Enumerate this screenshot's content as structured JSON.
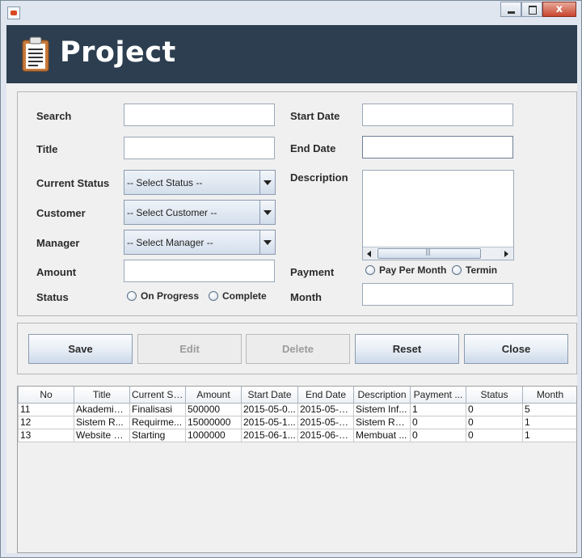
{
  "window": {
    "controls": {
      "minimize_icon": "minimize-icon",
      "maximize_icon": "maximize-icon",
      "close_glyph": "x"
    }
  },
  "header": {
    "title": "Project",
    "icon": "clipboard-icon"
  },
  "form": {
    "search": {
      "label": "Search",
      "value": ""
    },
    "title": {
      "label": "Title",
      "value": ""
    },
    "current_status": {
      "label": "Current Status",
      "selected": "-- Select Status --"
    },
    "customer": {
      "label": "Customer",
      "selected": "-- Select Customer --"
    },
    "manager": {
      "label": "Manager",
      "selected": "-- Select Manager --"
    },
    "amount": {
      "label": "Amount",
      "value": ""
    },
    "status": {
      "label": "Status",
      "options": [
        "On Progress",
        "Complete"
      ]
    },
    "start_date": {
      "label": "Start Date",
      "value": ""
    },
    "end_date": {
      "label": "End Date",
      "value": ""
    },
    "description": {
      "label": "Description",
      "value": ""
    },
    "payment": {
      "label": "Payment",
      "options": [
        "Pay Per Month",
        "Termin"
      ]
    },
    "month": {
      "label": "Month",
      "value": ""
    }
  },
  "buttons": {
    "save": "Save",
    "edit": "Edit",
    "delete": "Delete",
    "reset": "Reset",
    "close": "Close"
  },
  "table": {
    "columns": [
      "No",
      "Title",
      "Current St...",
      "Amount",
      "Start Date",
      "End Date",
      "Description",
      "Payment ...",
      "Status",
      "Month"
    ],
    "rows": [
      [
        "11",
        "Akademik ...",
        "Finalisasi",
        "500000",
        "2015-05-0...",
        "2015-05-1...",
        "Sistem Inf...",
        "1",
        "0",
        "5"
      ],
      [
        "12",
        "Sistem R...",
        "Requirme...",
        "15000000",
        "2015-05-1...",
        "2015-05-3...",
        "Sistem Re...",
        "0",
        "0",
        "1"
      ],
      [
        "13",
        "Website C...",
        "Starting",
        "1000000",
        "2015-06-1...",
        "2015-06-3...",
        "Membuat ...",
        "0",
        "0",
        "1"
      ]
    ]
  },
  "colors": {
    "header_bg": "#2c3e50",
    "header_text": "#ffffff"
  }
}
